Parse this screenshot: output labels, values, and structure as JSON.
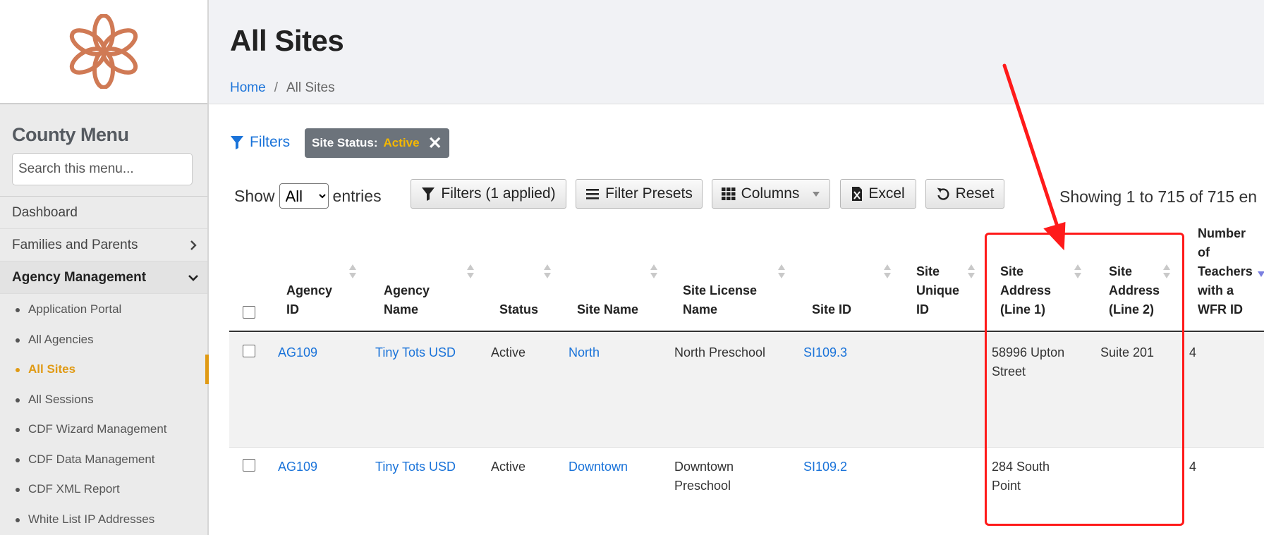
{
  "app": {
    "logo_icon": "flower-logo-icon",
    "brand_color": "#d07a55",
    "accent_color": "#e09a14",
    "link_color": "#1a73d9"
  },
  "sidebar": {
    "title": "County Menu",
    "search_placeholder": "Search this menu...",
    "items": [
      {
        "label": "Dashboard"
      },
      {
        "label": "Families and Parents",
        "icon": "chevron-right-icon"
      },
      {
        "label": "Agency Management",
        "icon": "chevron-down-icon",
        "expanded": true
      }
    ],
    "subitems": [
      {
        "label": "Application Portal"
      },
      {
        "label": "All Agencies"
      },
      {
        "label": "All Sites",
        "current": true
      },
      {
        "label": "All Sessions"
      },
      {
        "label": "CDF Wizard Management"
      },
      {
        "label": "CDF Data Management"
      },
      {
        "label": "CDF XML Report"
      },
      {
        "label": "White List IP Addresses"
      }
    ]
  },
  "header": {
    "title": "All Sites",
    "breadcrumb": {
      "home": "Home",
      "separator": "/",
      "current": "All Sites"
    }
  },
  "filters": {
    "link_label": "Filters",
    "chip_label": "Site Status:",
    "chip_value": "Active",
    "chip_close": "✕"
  },
  "toolbar": {
    "show_label": "Show",
    "show_value": "All",
    "entries_label": "entries",
    "filters_btn": "Filters (1 applied)",
    "presets_btn": "Filter Presets",
    "columns_btn": "Columns",
    "excel_btn": "Excel",
    "reset_btn": "Reset",
    "showing_text": "Showing 1 to 715 of 715 en"
  },
  "table": {
    "columns": [
      {
        "line1": "Agency",
        "line2": "ID"
      },
      {
        "line1": "Agency",
        "line2": "Name"
      },
      {
        "line1": "Status"
      },
      {
        "line1": "Site Name"
      },
      {
        "line1": "Site License",
        "line2": "Name"
      },
      {
        "line1": "Site ID"
      },
      {
        "line1": "Site",
        "line2": "Unique",
        "line3": "ID"
      },
      {
        "line1": "Site",
        "line2": "Address",
        "line3": "(Line 1)"
      },
      {
        "line1": "Site",
        "line2": "Address",
        "line3": "(Line 2)"
      },
      {
        "line1": "Number",
        "line2": "of",
        "line3": "Teachers",
        "line4": "with a",
        "line5": "WFR ID"
      }
    ],
    "rows": [
      {
        "agency_id": "AG109",
        "agency_name": "Tiny Tots USD",
        "status": "Active",
        "site_name": "North",
        "license_line1": "North Preschool",
        "license_line2": "",
        "site_id": "SI109.3",
        "unique_id": "",
        "address1_line1": "58996 Upton",
        "address1_line2": "Street",
        "address2": "Suite 201",
        "teachers": "4"
      },
      {
        "agency_id": "AG109",
        "agency_name": "Tiny Tots USD",
        "status": "Active",
        "site_name": "Downtown",
        "license_line1": "Downtown",
        "license_line2": "Preschool",
        "site_id": "SI109.2",
        "unique_id": "",
        "address1_line1": "284 South",
        "address1_line2": "Point",
        "address2": "",
        "teachers": "4"
      }
    ]
  },
  "annotation": {
    "color": "#ff1a1a",
    "highlight": "site-address-columns"
  }
}
